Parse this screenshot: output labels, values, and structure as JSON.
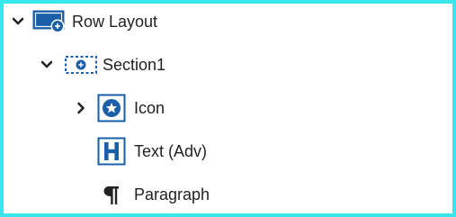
{
  "colors": {
    "frame_border": "#38e6ee",
    "icon_blue": "#1a5fa8",
    "text": "#222222",
    "background": "#ffffff"
  },
  "tree": {
    "items": [
      {
        "label": "Row Layout",
        "icon": "row-layout-icon",
        "expander": "chevron-down-icon",
        "depth": 0
      },
      {
        "label": "Section1",
        "icon": "section-icon",
        "expander": "chevron-down-icon",
        "depth": 1
      },
      {
        "label": "Icon",
        "icon": "star-badge-icon",
        "expander": "chevron-right-icon",
        "depth": 2
      },
      {
        "label": "Text (Adv)",
        "icon": "heading-h-icon",
        "expander": "",
        "depth": 2
      },
      {
        "label": "Paragraph",
        "icon": "pilcrow-icon",
        "expander": "",
        "depth": 2
      }
    ]
  }
}
